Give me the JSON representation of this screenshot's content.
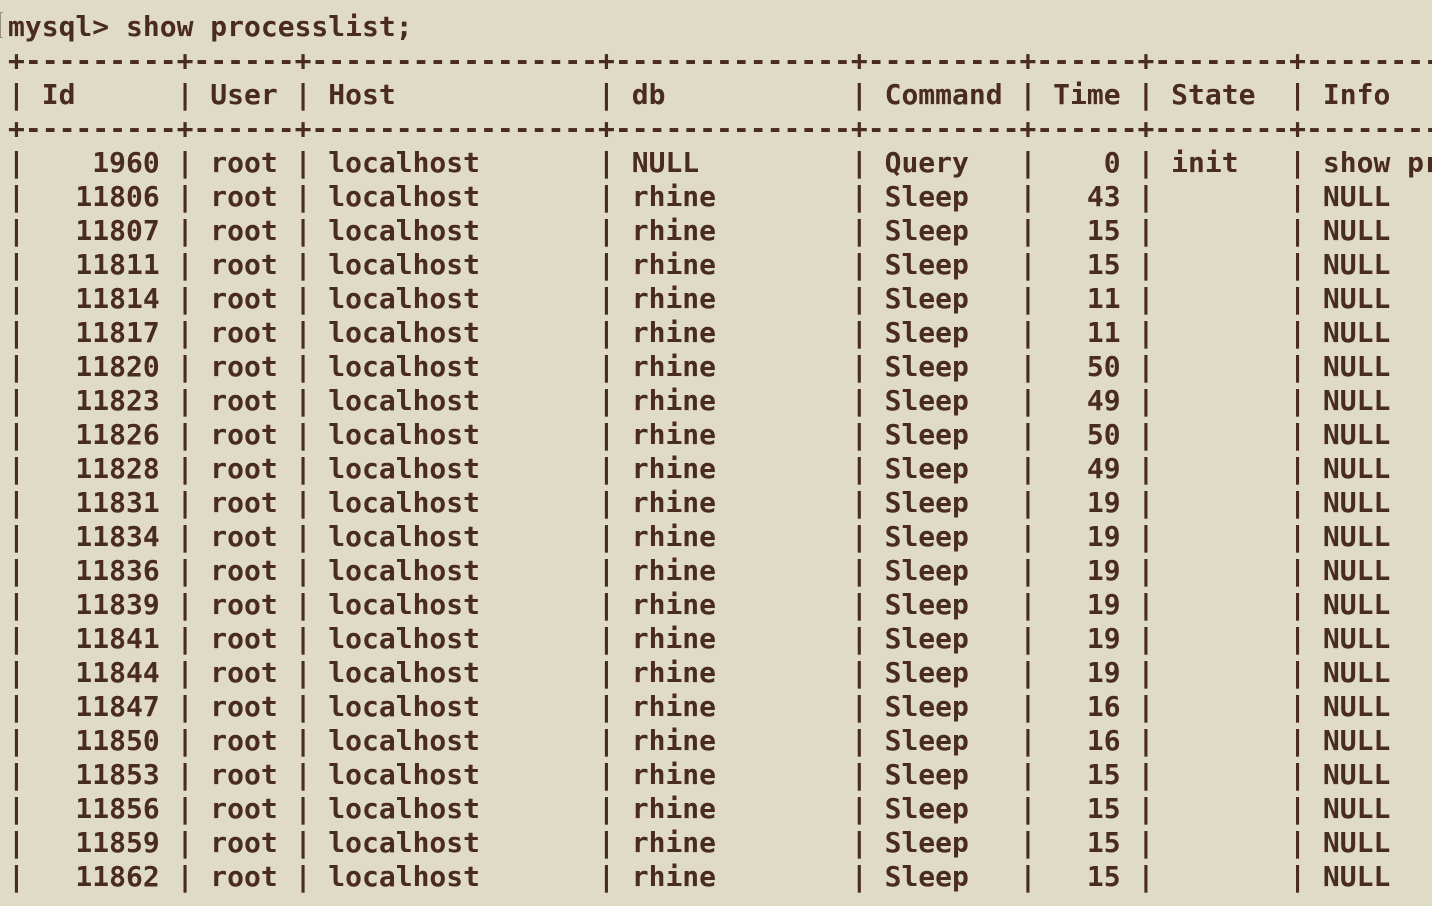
{
  "terminal": {
    "command_line": "mysql> show processlist;",
    "columns": [
      {
        "header": "Id",
        "width": 7,
        "align": "right"
      },
      {
        "header": "User",
        "width": 4,
        "align": "left"
      },
      {
        "header": "Host",
        "width": 15,
        "align": "left"
      },
      {
        "header": "db",
        "width": 12,
        "align": "left"
      },
      {
        "header": "Command",
        "width": 7,
        "align": "left"
      },
      {
        "header": "Time",
        "width": 4,
        "align": "right"
      },
      {
        "header": "State",
        "width": 6,
        "align": "left"
      },
      {
        "header": "Info",
        "width": 16,
        "align": "left"
      }
    ],
    "rows": [
      [
        "1960",
        "root",
        "localhost",
        "NULL",
        "Query",
        "0",
        "init",
        "show processlist"
      ],
      [
        "11806",
        "root",
        "localhost",
        "rhine",
        "Sleep",
        "43",
        "",
        "NULL"
      ],
      [
        "11807",
        "root",
        "localhost",
        "rhine",
        "Sleep",
        "15",
        "",
        "NULL"
      ],
      [
        "11811",
        "root",
        "localhost",
        "rhine",
        "Sleep",
        "15",
        "",
        "NULL"
      ],
      [
        "11814",
        "root",
        "localhost",
        "rhine",
        "Sleep",
        "11",
        "",
        "NULL"
      ],
      [
        "11817",
        "root",
        "localhost",
        "rhine",
        "Sleep",
        "11",
        "",
        "NULL"
      ],
      [
        "11820",
        "root",
        "localhost",
        "rhine",
        "Sleep",
        "50",
        "",
        "NULL"
      ],
      [
        "11823",
        "root",
        "localhost",
        "rhine",
        "Sleep",
        "49",
        "",
        "NULL"
      ],
      [
        "11826",
        "root",
        "localhost",
        "rhine",
        "Sleep",
        "50",
        "",
        "NULL"
      ],
      [
        "11828",
        "root",
        "localhost",
        "rhine",
        "Sleep",
        "49",
        "",
        "NULL"
      ],
      [
        "11831",
        "root",
        "localhost",
        "rhine",
        "Sleep",
        "19",
        "",
        "NULL"
      ],
      [
        "11834",
        "root",
        "localhost",
        "rhine",
        "Sleep",
        "19",
        "",
        "NULL"
      ],
      [
        "11836",
        "root",
        "localhost",
        "rhine",
        "Sleep",
        "19",
        "",
        "NULL"
      ],
      [
        "11839",
        "root",
        "localhost",
        "rhine",
        "Sleep",
        "19",
        "",
        "NULL"
      ],
      [
        "11841",
        "root",
        "localhost",
        "rhine",
        "Sleep",
        "19",
        "",
        "NULL"
      ],
      [
        "11844",
        "root",
        "localhost",
        "rhine",
        "Sleep",
        "19",
        "",
        "NULL"
      ],
      [
        "11847",
        "root",
        "localhost",
        "rhine",
        "Sleep",
        "16",
        "",
        "NULL"
      ],
      [
        "11850",
        "root",
        "localhost",
        "rhine",
        "Sleep",
        "16",
        "",
        "NULL"
      ],
      [
        "11853",
        "root",
        "localhost",
        "rhine",
        "Sleep",
        "15",
        "",
        "NULL"
      ],
      [
        "11856",
        "root",
        "localhost",
        "rhine",
        "Sleep",
        "15",
        "",
        "NULL"
      ],
      [
        "11859",
        "root",
        "localhost",
        "rhine",
        "Sleep",
        "15",
        "",
        "NULL"
      ],
      [
        "11862",
        "root",
        "localhost",
        "rhine",
        "Sleep",
        "15",
        "",
        "NULL"
      ]
    ],
    "colors": {
      "background": "#e0dbc4",
      "text": "#4a2b1f"
    }
  }
}
